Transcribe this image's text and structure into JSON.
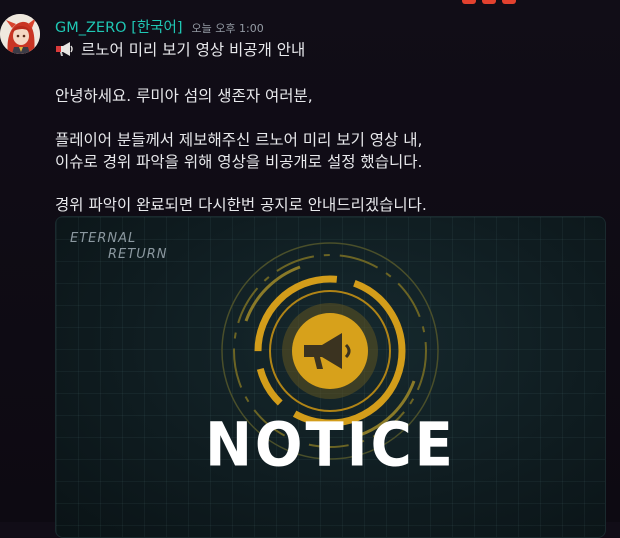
{
  "message": {
    "author": "GM_ZERO [한국어]",
    "timestamp": "오늘 오후 1:00",
    "title": "르노어 미리 보기 영상 비공개 안내",
    "lines": [
      "안녕하세요. 루미아 섬의 생존자 여러분,",
      "플레이어 분들께서 제보해주신 르노어 미리 보기 영상 내,",
      "이슈로 경위 파악을 위해 영상을 비공개로 설정 했습니다.",
      "경위 파악이 완료되면 다시한번 공지로 안내드리겠습니다."
    ]
  },
  "embed": {
    "logo_line1": "ETERNAL",
    "logo_line2": "RETURN",
    "notice": "NOTICE"
  },
  "colors": {
    "author": "#1fc7b4",
    "accent_gold": "#d9a21c",
    "background": "#110d17"
  },
  "icons": [
    "megaphone-icon",
    "avatar"
  ]
}
